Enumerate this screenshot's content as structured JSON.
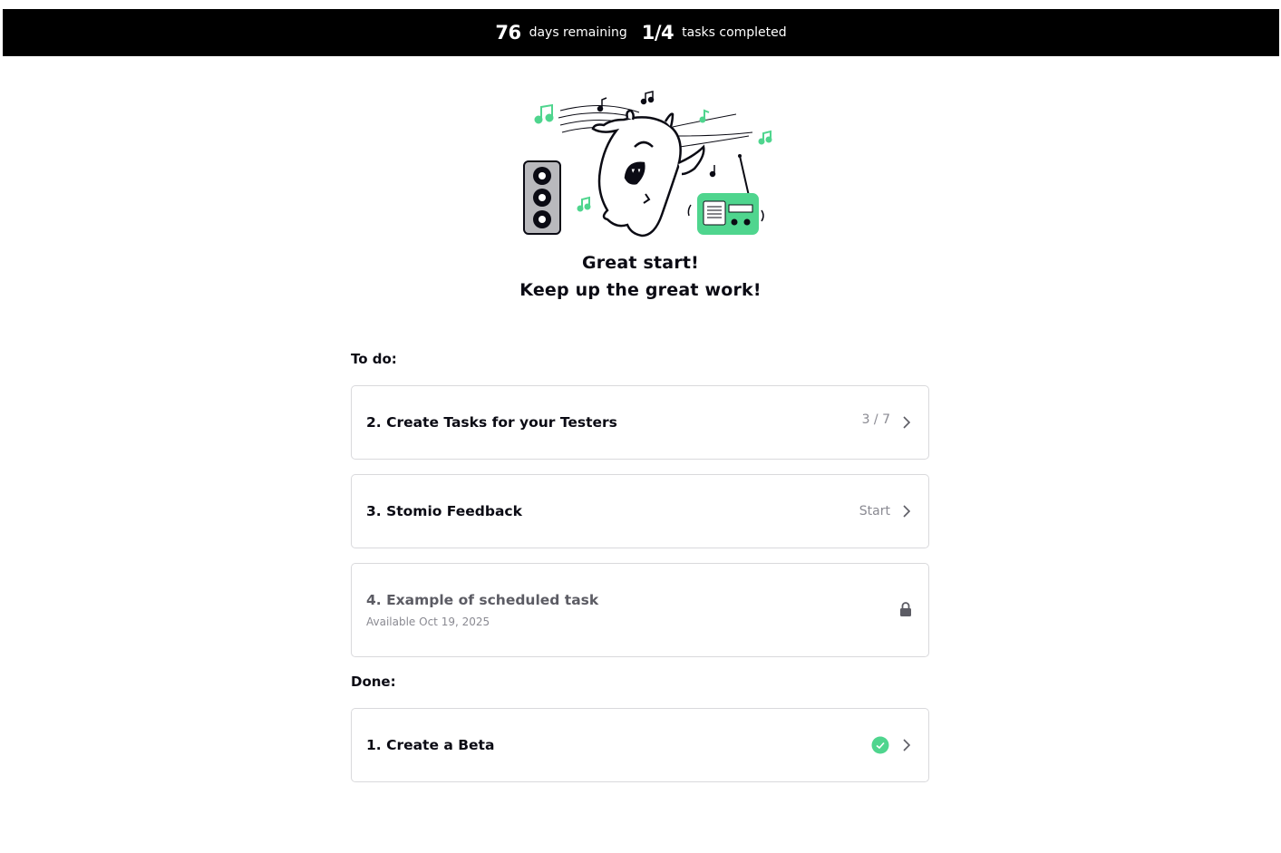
{
  "header": {
    "days_remaining_value": "76",
    "days_remaining_label": "days remaining",
    "tasks_value": "1/4",
    "tasks_label": "tasks completed"
  },
  "hero": {
    "line1": "Great start!",
    "line2": "Keep up the great work!"
  },
  "todo": {
    "label": "To do:",
    "tasks": [
      {
        "title": "2. Create Tasks for your Testers",
        "status": "3 / 7"
      },
      {
        "title": "3. Stomio Feedback",
        "status": "Start"
      },
      {
        "title": "4. Example of scheduled task",
        "subtitle": "Available Oct 19, 2025"
      }
    ]
  },
  "done": {
    "label": "Done:",
    "tasks": [
      {
        "title": "1. Create a Beta"
      }
    ]
  },
  "colors": {
    "accent_green": "#4fd58e",
    "ink": "#0b0b14",
    "muted": "#8a8a92",
    "border": "#d9d9dc"
  }
}
